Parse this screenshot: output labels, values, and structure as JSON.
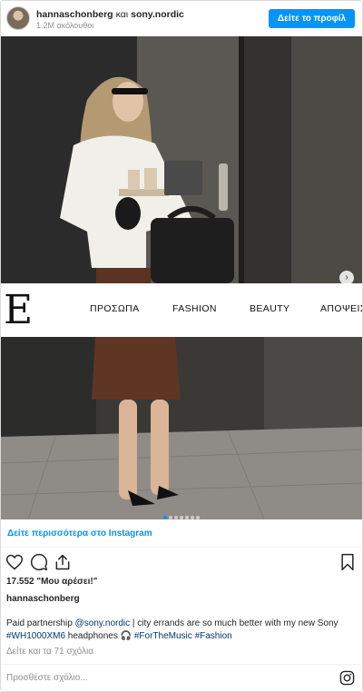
{
  "header": {
    "username": "hannaschonberg",
    "conjunction": "και",
    "partner": "sony.nordic",
    "followers": "1.2M ακόλουθοι",
    "profile_button": "Δείτε το προφίλ"
  },
  "media": {
    "brand_letter": "E",
    "nav": [
      "ΠΡΟΣΩΠΑ",
      "FASHION",
      "BEAUTY",
      "ΑΠΟΨΕΙΣ"
    ],
    "next_icon": "chevron-right-icon",
    "carousel": {
      "total": 7,
      "active": 1
    }
  },
  "more_link": "Δείτε περισσότερα στο Instagram",
  "actions": {
    "icons": [
      "heart-icon",
      "comment-icon",
      "share-icon",
      "bookmark-icon"
    ]
  },
  "likes": "17.552 \"Μου αρέσει!\"",
  "owner": "hannaschonberg",
  "caption": {
    "prefix": "Paid partnership ",
    "mention": "@sony.nordic",
    "text1": " | city errands are so much better with my new Sony ",
    "hashtag1": "#WH1000XM6",
    "text2": " headphones 🎧 ",
    "hashtag2": "#ForTheMusic",
    "hashtag3": "#Fashion"
  },
  "comments_link": "Δείτε και τα 71 σχόλια",
  "comment_placeholder": "Προσθέστε σχόλιο...",
  "colors": {
    "accent": "#0095f6",
    "link": "#00376b",
    "muted": "#8e8e8e"
  }
}
